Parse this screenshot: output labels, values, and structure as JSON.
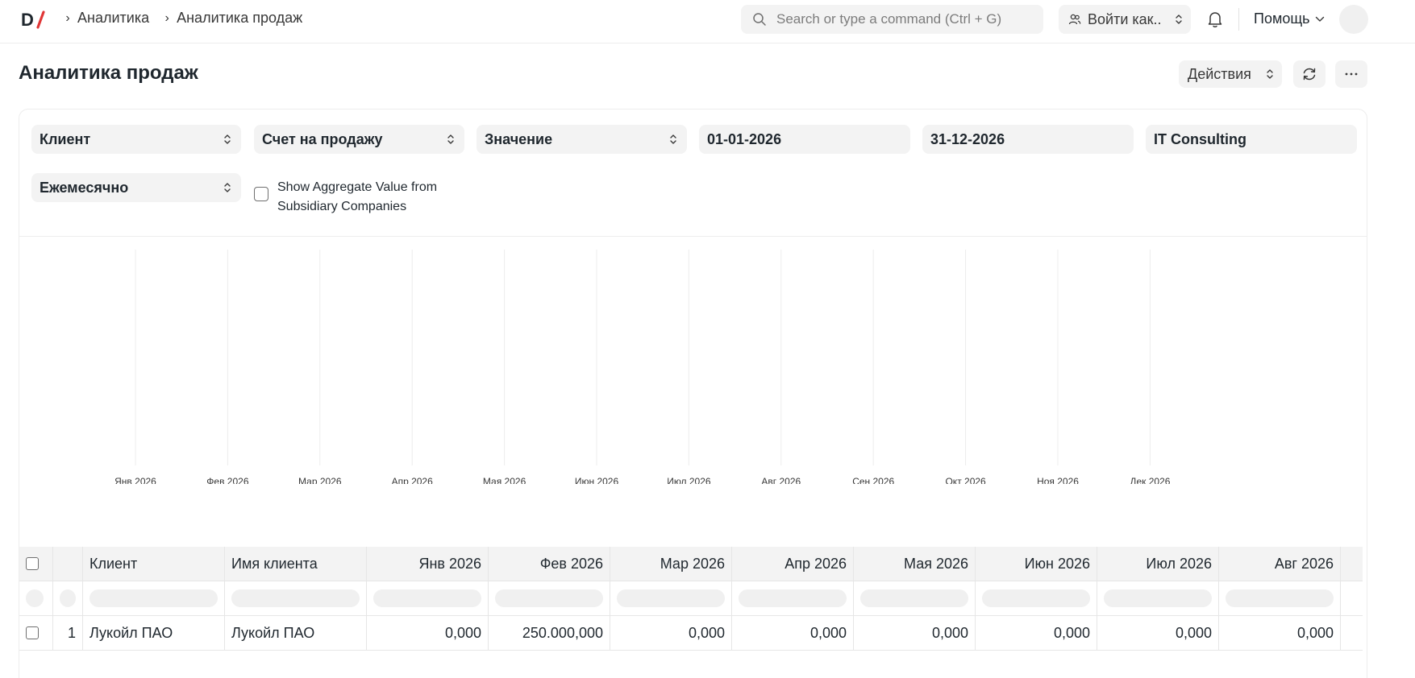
{
  "navbar": {
    "breadcrumbs": [
      "Аналитика",
      "Аналитика продаж"
    ],
    "search_placeholder": "Search or type a command (Ctrl + G)",
    "login_as_label": "Войти как..",
    "help_label": "Помощь"
  },
  "page": {
    "title": "Аналитика продаж",
    "actions_label": "Действия"
  },
  "filters": {
    "tree_type": "Клиент",
    "doc_type": "Счет на продажу",
    "value_quantity": "Значение",
    "from_date": "01-01-2026",
    "to_date": "31-12-2026",
    "company": "IT Consulting",
    "range": "Ежемесячно",
    "aggregate_label": "Show Aggregate Value from Subsidiary Companies",
    "aggregate_checked": false
  },
  "chart_data": {
    "type": "line",
    "categories": [
      "Янв 2026",
      "Фев 2026",
      "Мар 2026",
      "Апр 2026",
      "Мая 2026",
      "Июн 2026",
      "Июл 2026",
      "Авг 2026",
      "Сен 2026",
      "Окт 2026",
      "Ноя 2026",
      "Дек 2026"
    ],
    "series": [],
    "title": "",
    "xlabel": "",
    "ylabel": "",
    "grid": "vertical"
  },
  "table": {
    "columns": [
      "Клиент",
      "Имя клиента",
      "Янв 2026",
      "Фев 2026",
      "Мар 2026",
      "Апр 2026",
      "Мая 2026",
      "Июн 2026",
      "Июл 2026",
      "Авг 2026"
    ],
    "rows": [
      {
        "index": "1",
        "cells": [
          "Лукойл ПАО",
          "Лукойл ПАО",
          "0,000",
          "250.000,000",
          "0,000",
          "0,000",
          "0,000",
          "0,000",
          "0,000",
          "0,000"
        ]
      }
    ]
  }
}
